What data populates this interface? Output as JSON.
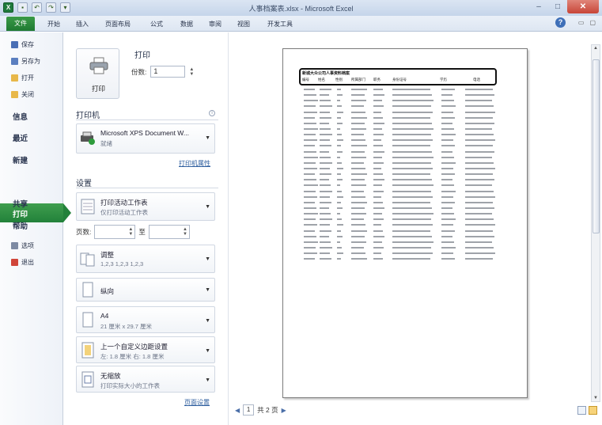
{
  "window": {
    "title": "人事档案表.xlsx - Microsoft Excel",
    "controls": {
      "minimize": "–",
      "maximize": "□",
      "close": "✕"
    }
  },
  "ribbon": {
    "tabs": [
      "文件",
      "开始",
      "插入",
      "页面布局",
      "公式",
      "数据",
      "审阅",
      "视图",
      "开发工具"
    ],
    "help": "?"
  },
  "backstage_nav": {
    "commands": [
      "保存",
      "另存为",
      "打开",
      "关闭"
    ],
    "items": [
      "信息",
      "最近",
      "新建",
      "打印",
      "共享",
      "帮助"
    ],
    "tail_commands": [
      "选项",
      "退出"
    ],
    "active": "打印"
  },
  "print": {
    "section_title": "打印",
    "button_label": "打印",
    "copies_label": "份数:",
    "copies_value": "1"
  },
  "printer": {
    "section_title": "打印机",
    "name": "Microsoft XPS Document W...",
    "status": "就绪",
    "properties_link": "打印机属性"
  },
  "settings": {
    "section_title": "设置",
    "scope_main": "打印活动工作表",
    "scope_sub": "仅打印活动工作表",
    "pages_label": "页数:",
    "pages_to_label": "至",
    "collate_main": "调整",
    "collate_sub": "1,2,3    1,2,3    1,2,3",
    "orientation": "纵向",
    "paper_main": "A4",
    "paper_sub": "21 厘米 x 29.7 厘米",
    "margins_main": "上一个自定义边距设置",
    "margins_sub": "左: 1.8 厘米    右: 1.8 厘米",
    "scaling_main": "无缩放",
    "scaling_sub": "打印实际大小的工作表",
    "page_setup_link": "页面设置"
  },
  "preview": {
    "doc_title": "新城大众公司人事资料档案",
    "columns": [
      "编号",
      "姓名",
      "性别",
      "所属部门",
      "职务",
      "身份证号",
      "学历",
      "电话"
    ],
    "row_count": 31,
    "current_page": "1",
    "total_pages_text": "共 2 页"
  },
  "colors": {
    "accent_green": "#22813a",
    "title_bar": "#c5d5ea",
    "close_button": "#c74537"
  }
}
